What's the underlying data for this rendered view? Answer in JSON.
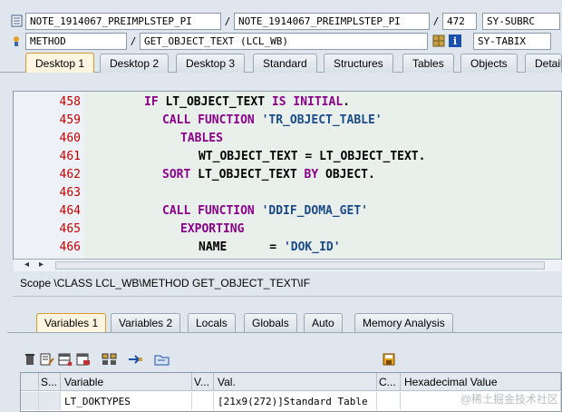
{
  "header": {
    "row1": {
      "program": "NOTE_1914067_PREIMPLSTEP_PI",
      "include": "NOTE_1914067_PREIMPLSTEP_PI",
      "line": "472",
      "sysfield": "SY-SUBRC"
    },
    "row2": {
      "type": "METHOD",
      "name": "GET_OBJECT_TEXT (LCL_WB)",
      "sysfield": "SY-TABIX"
    },
    "separator": "/"
  },
  "tabs": [
    "Desktop 1",
    "Desktop 2",
    "Desktop 3",
    "Standard",
    "Structures",
    "Tables",
    "Objects",
    "Detail"
  ],
  "editor": {
    "lines": [
      {
        "no": "458",
        "code": [
          {
            "t": "IF ",
            "c": "kw"
          },
          {
            "t": "LT_OBJECT_TEXT ",
            "c": "tx"
          },
          {
            "t": "IS INITIAL",
            "c": "kw"
          },
          {
            "t": ".",
            "c": "tx"
          }
        ]
      },
      {
        "no": "459",
        "code": [
          {
            "t": "CALL FUNCTION ",
            "c": "kw"
          },
          {
            "t": "'TR_OBJECT_TABLE'",
            "c": "str"
          }
        ]
      },
      {
        "no": "460",
        "code": [
          {
            "t": "TABLES",
            "c": "kw"
          }
        ]
      },
      {
        "no": "461",
        "code": [
          {
            "t": "WT_OBJECT_TEXT ",
            "c": "tx"
          },
          {
            "t": "= ",
            "c": "tx"
          },
          {
            "t": "LT_OBJECT_TEXT.",
            "c": "tx"
          }
        ]
      },
      {
        "no": "462",
        "code": [
          {
            "t": "SORT ",
            "c": "kw"
          },
          {
            "t": "LT_OBJECT_TEXT ",
            "c": "tx"
          },
          {
            "t": "BY ",
            "c": "kw"
          },
          {
            "t": "OBJECT.",
            "c": "tx"
          }
        ]
      },
      {
        "no": "463",
        "code": []
      },
      {
        "no": "464",
        "code": [
          {
            "t": "CALL FUNCTION ",
            "c": "kw"
          },
          {
            "t": "'DDIF_DOMA_GET'",
            "c": "str"
          }
        ]
      },
      {
        "no": "465",
        "code": [
          {
            "t": "EXPORTING",
            "c": "kw"
          }
        ]
      },
      {
        "no": "466",
        "code": [
          {
            "t": "NAME      ",
            "c": "tx"
          },
          {
            "t": "= ",
            "c": "tx"
          },
          {
            "t": "'DOK_ID'",
            "c": "str"
          }
        ]
      }
    ]
  },
  "scope": "Scope \\CLASS LCL_WB\\METHOD GET_OBJECT_TEXT\\IF",
  "var_tabs": [
    "Variables 1",
    "Variables 2",
    "Locals",
    "Globals",
    "Auto",
    "Memory Analysis"
  ],
  "grid": {
    "headers": [
      "S...",
      "Variable",
      "V...",
      "Val.",
      "C...",
      "Hexadecimal Value"
    ],
    "rows": [
      {
        "variable": "LT_DOKTYPES",
        "value": "[21x9(272)]Standard Table"
      }
    ]
  },
  "watermark": "@稀土掘金技术社区",
  "colors": {
    "keyword": "#8b008b",
    "string": "#1a4a8a",
    "linenumber": "#c00000",
    "active_tab": "#fff5e0"
  }
}
